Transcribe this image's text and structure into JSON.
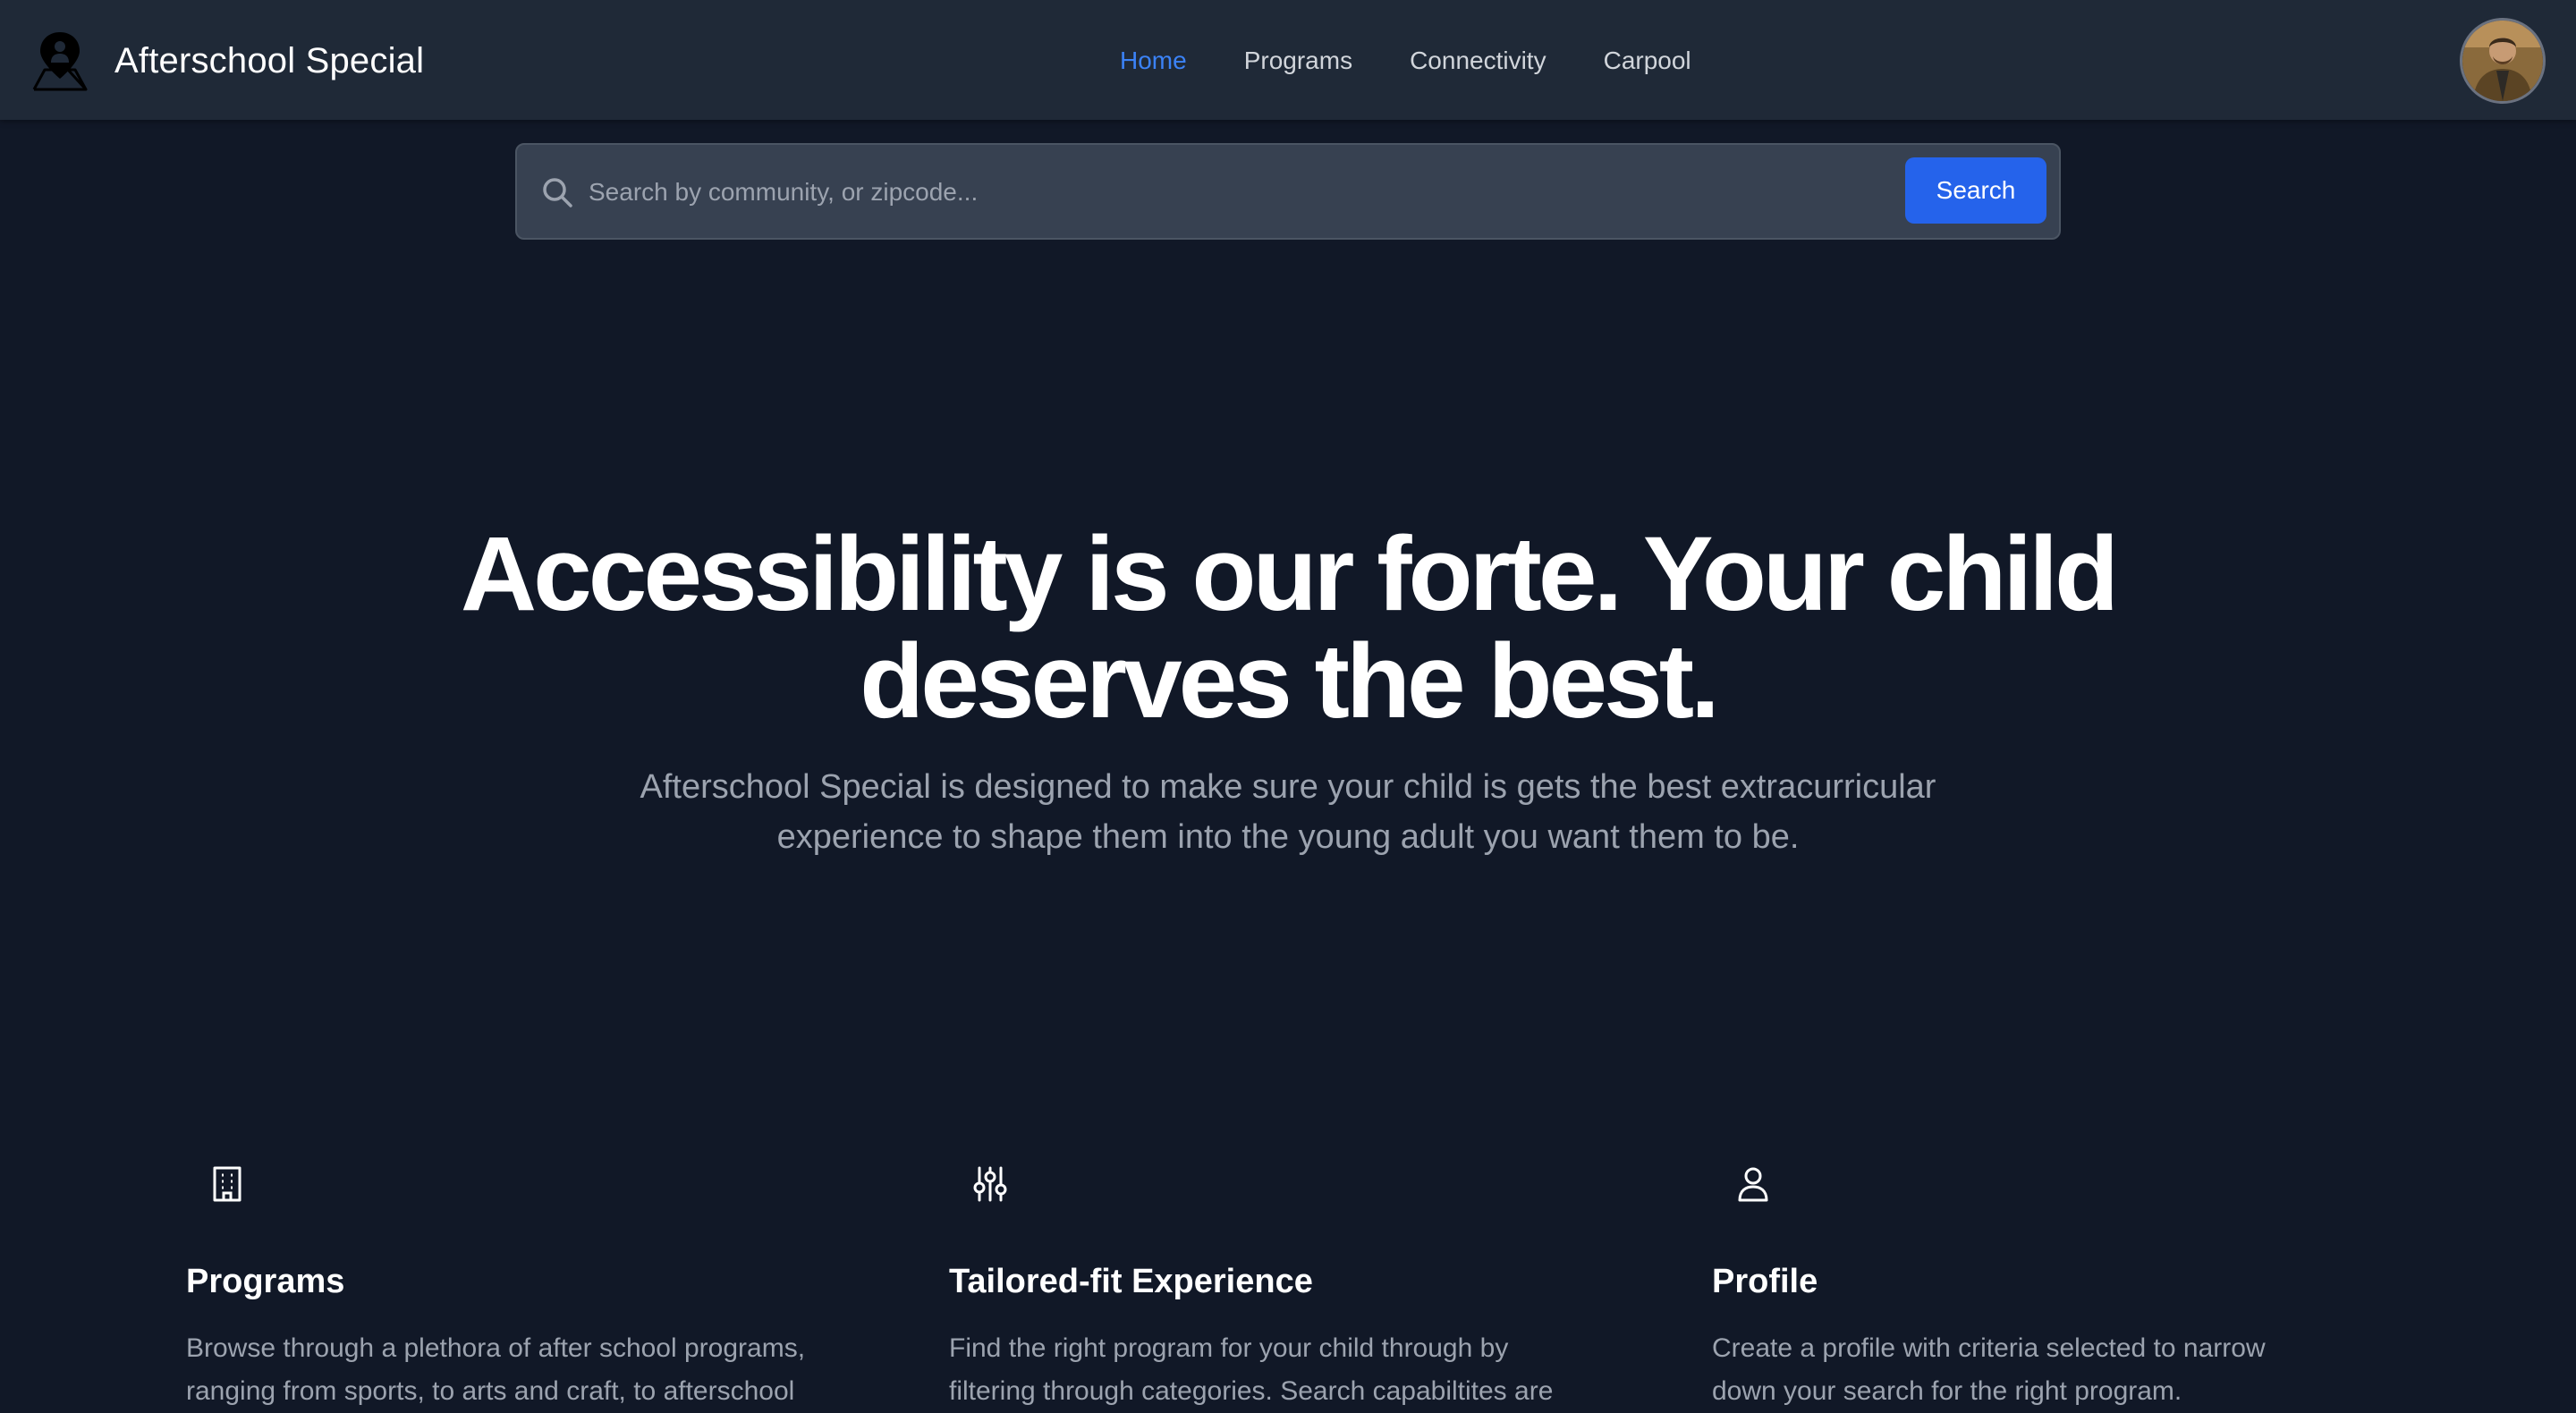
{
  "navbar": {
    "brand_name": "Afterschool Special",
    "links": [
      {
        "label": "Home",
        "active": true
      },
      {
        "label": "Programs",
        "active": false
      },
      {
        "label": "Connectivity",
        "active": false
      },
      {
        "label": "Carpool",
        "active": false
      }
    ],
    "logo_icon": "map-pin-person-icon",
    "avatar_icon": "user-avatar"
  },
  "search": {
    "placeholder": "Search by community, or zipcode...",
    "value": "",
    "button_label": "Search",
    "icon": "search-icon"
  },
  "hero": {
    "title_line1": "Accessibility is our forte. Your child",
    "title_line2": "deserves the best.",
    "subtitle_line1": "Afterschool Special is designed to make sure your child is gets the best extracurricular",
    "subtitle_line2": "experience to shape them into the young adult you want them to be."
  },
  "features": [
    {
      "icon": "building-icon",
      "title": "Programs",
      "text_line1": "Browse through a plethora of after school programs,",
      "text_line2": "ranging from sports, to arts and craft, to afterschool"
    },
    {
      "icon": "sliders-icon",
      "title": "Tailored-fit Experience",
      "text_line1": "Find the right program for your child through by",
      "text_line2": "filtering through categories. Search capabiltites are"
    },
    {
      "icon": "user-icon",
      "title": "Profile",
      "text_line1": "Create a profile with criteria selected to narrow",
      "text_line2": "down your search for the right program."
    }
  ],
  "colors": {
    "background": "#111827",
    "navbar": "#1f2937",
    "accent": "#2563eb",
    "active_link": "#3b82f6",
    "muted_text": "#9ca3af"
  }
}
